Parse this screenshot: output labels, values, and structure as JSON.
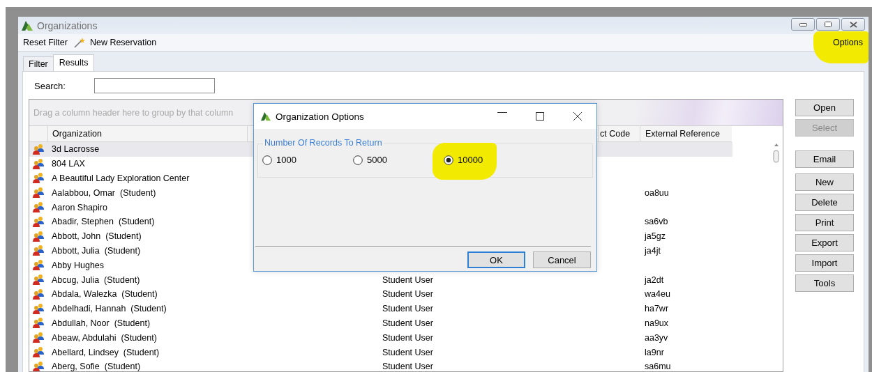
{
  "window": {
    "title": "Organizations"
  },
  "toolbar": {
    "items": [
      {
        "label": "Reset Filter",
        "kind": "plain"
      },
      {
        "label": "New Reservation",
        "kind": "wand"
      }
    ],
    "options": "Options"
  },
  "tabs": [
    {
      "label": "Filter",
      "selected": false
    },
    {
      "label": "Results",
      "selected": true
    }
  ],
  "search": {
    "label": "Search:"
  },
  "grid": {
    "group_hint": "Drag a column header here to group by that column",
    "headers": {
      "organization": "Organization",
      "column_4": "ct Code",
      "external_reference": "External Reference"
    },
    "rows": [
      {
        "organization": "3d Lacrosse",
        "selected": true
      },
      {
        "organization": "804 LAX",
        "selected": false
      },
      {
        "organization": "A Beautiful Lady Exploration Center",
        "selected": false
      },
      {
        "organization": "Aalabbou, Omar  (Student)",
        "external_reference": "oa8uu",
        "selected": false
      },
      {
        "organization": "Aaron Shapiro",
        "selected": false
      },
      {
        "organization": "Abadir, Stephen  (Student)",
        "external_reference": "sa6vb",
        "selected": false
      },
      {
        "organization": "Abbott, John  (Student)",
        "external_reference": "ja5gz",
        "selected": false
      },
      {
        "organization": "Abbott, Julia  (Student)",
        "external_reference": "ja4jt",
        "selected": false
      },
      {
        "organization": "Abby Hughes",
        "selected": false
      },
      {
        "organization": "Abcug, Julia  (Student)",
        "column_3": "Student User",
        "external_reference": "ja2dt",
        "selected": false
      },
      {
        "organization": "Abdala, Walezka  (Student)",
        "column_3": "Student User",
        "external_reference": "wa4eu",
        "selected": false
      },
      {
        "organization": "Abdelhadi, Hannah  (Student)",
        "column_3": "Student User",
        "external_reference": "ha7wr",
        "selected": false
      },
      {
        "organization": "Abdullah, Noor  (Student)",
        "column_3": "Student User",
        "external_reference": "na9ux",
        "selected": false
      },
      {
        "organization": "Abeaw, Abdulahi  (Student)",
        "column_3": "Student User",
        "external_reference": "aa3yv",
        "selected": false
      },
      {
        "organization": "Abellard, Lindsey  (Student)",
        "column_3": "Student User",
        "external_reference": "la9nr",
        "selected": false
      },
      {
        "organization": "Aberg, Sofie  (Student)",
        "column_3": "Student User",
        "external_reference": "sa6mu",
        "selected": false
      }
    ]
  },
  "side_buttons": [
    [
      {
        "label": "Open",
        "disabled": false
      },
      {
        "label": "Select",
        "disabled": true
      }
    ],
    [
      {
        "label": "Email",
        "disabled": false
      }
    ],
    [
      {
        "label": "New",
        "disabled": false
      },
      {
        "label": "Delete",
        "disabled": false
      },
      {
        "label": "Print",
        "disabled": false
      },
      {
        "label": "Export",
        "disabled": false
      },
      {
        "label": "Import",
        "disabled": false
      },
      {
        "label": "Tools",
        "disabled": false
      }
    ]
  ],
  "dialog": {
    "title": "Organization Options",
    "group_title": "Number Of Records To Return",
    "options": [
      {
        "label": "1000",
        "selected": false
      },
      {
        "label": "5000",
        "selected": false
      },
      {
        "label": "10000",
        "selected": true
      }
    ],
    "buttons": [
      {
        "label": "OK",
        "default": true
      },
      {
        "label": "Cancel",
        "default": false
      }
    ]
  }
}
